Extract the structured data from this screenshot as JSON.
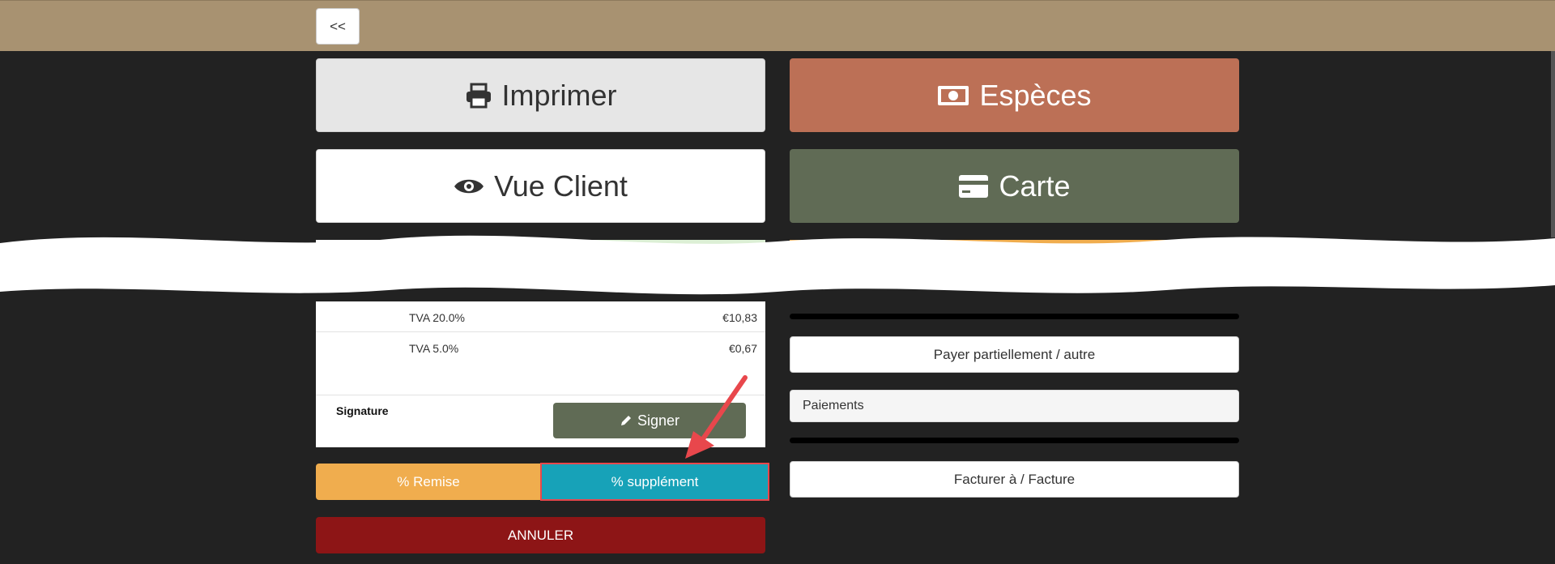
{
  "topbar": {
    "back_label": "<<"
  },
  "buttons": {
    "print_label": "Imprimer",
    "client_view_label": "Vue Client",
    "cash_label": "Espèces",
    "card_label": "Carte",
    "sign_label": "Signer",
    "discount_label": "% Remise",
    "surcharge_label": "% supplément",
    "cancel_label": "ANNULER",
    "partial_pay_label": "Payer partiellement / autre",
    "invoice_label": "Facturer à / Facture"
  },
  "taxes": [
    {
      "label": "TVA 20.0%",
      "value": "€10,83"
    },
    {
      "label": "TVA 5.0%",
      "value": "€0,67"
    }
  ],
  "signature_label": "Signature",
  "payments_label": "Paiements",
  "icons": {
    "print": "print-icon",
    "eye": "eye-icon",
    "cash": "money-bill-icon",
    "card": "credit-card-icon",
    "pencil": "pencil-icon",
    "annotation_arrow": "red-arrow-annotation"
  },
  "colors": {
    "topbar": "#a89271",
    "background": "#222222",
    "cash": "#bc7056",
    "card": "#606b55",
    "discount": "#f0ad4e",
    "surcharge": "#17a2b8",
    "cancel": "#8d1516",
    "highlight": "#e8474c"
  }
}
